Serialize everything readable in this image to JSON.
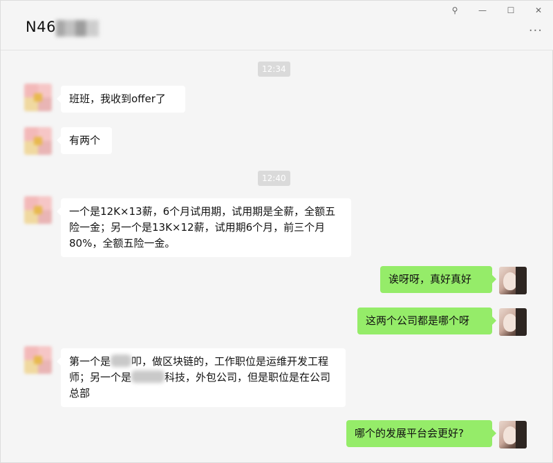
{
  "header": {
    "contact_name": "N46",
    "more_label": "···",
    "controls": {
      "pin": "⚲",
      "minimize": "—",
      "maximize": "☐",
      "close": "✕"
    }
  },
  "chat": {
    "time_1": "12:34",
    "time_2": "12:40",
    "msg_1": "班班，我收到offer了",
    "msg_2": "有两个",
    "msg_3": "一个是12K×13薪，6个月试用期，试用期是全薪，全额五险一金；另一个是13K×12薪，试用期6个月，前三个月80%，全额五险一金。",
    "msg_4": "诶呀呀，真好真好",
    "msg_5": "这两个公司都是哪个呀",
    "msg_6": {
      "part_a": "第一个是",
      "part_b": "叩，做区块链的，工作职位是运维开发工程师；另一个是",
      "part_c": "科技，外包公司，但是职位是在公司总部"
    },
    "msg_7": "哪个的发展平台会更好?"
  },
  "colors": {
    "background": "#f5f5f5",
    "incoming_bubble": "#ffffff",
    "outgoing_bubble": "#95ec69",
    "time_chip": "#dadada"
  },
  "icons": [
    "pin-icon",
    "minimize-icon",
    "maximize-icon",
    "close-icon",
    "more-icon"
  ]
}
